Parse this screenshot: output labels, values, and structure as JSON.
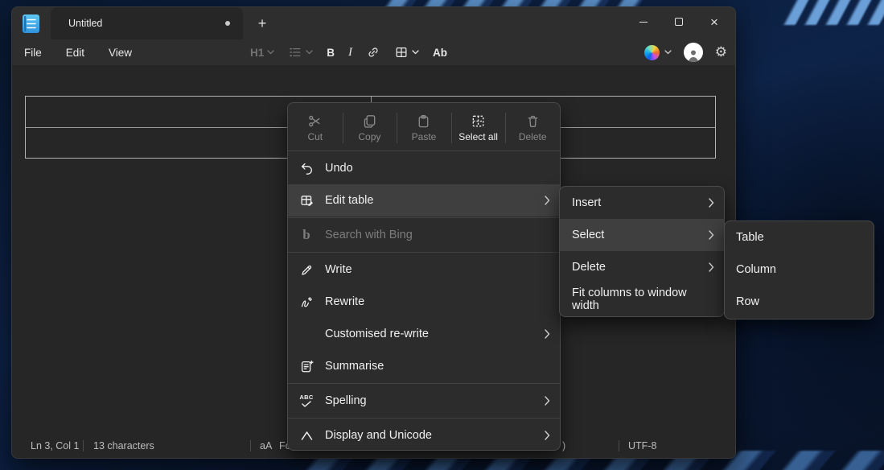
{
  "titlebar": {
    "tab_title": "Untitled",
    "unsaved_indicator": "unsaved-dot",
    "new_tab_label": "+",
    "close_label": "×"
  },
  "menubar": {
    "file": "File",
    "edit": "Edit",
    "view": "View"
  },
  "toolbar": {
    "heading_label": "H1",
    "bold_label": "B",
    "italic_label": "I",
    "proofing_label": "Ab"
  },
  "icons": {
    "gear": "⚙",
    "names": [
      "notepad-icon",
      "list-icon",
      "link-icon",
      "table-icon",
      "copilot-icon",
      "account-icon",
      "gear-icon",
      "scissors-icon",
      "copy-icon",
      "paste-icon",
      "select-all-icon",
      "trash-icon",
      "undo-icon",
      "edit-table-icon",
      "bing-icon",
      "write-icon",
      "rewrite-icon",
      "summarise-icon",
      "spelling-icon",
      "caret-icon",
      "chevron-down-icon",
      "chevron-right-icon"
    ]
  },
  "context_menu": {
    "commands": [
      {
        "label": "Cut",
        "enabled": false
      },
      {
        "label": "Copy",
        "enabled": false
      },
      {
        "label": "Paste",
        "enabled": false
      },
      {
        "label": "Select all",
        "enabled": true
      },
      {
        "label": "Delete",
        "enabled": false
      }
    ],
    "items": [
      {
        "label": "Undo",
        "enabled": true,
        "highlighted": false,
        "chevron": false
      },
      {
        "label": "Edit table",
        "enabled": true,
        "highlighted": true,
        "chevron": true
      },
      {
        "label": "Search with Bing",
        "enabled": false,
        "highlighted": false,
        "chevron": false
      },
      {
        "label": "Write",
        "enabled": true,
        "highlighted": false,
        "chevron": false
      },
      {
        "label": "Rewrite",
        "enabled": true,
        "highlighted": false,
        "chevron": false
      },
      {
        "label": "Customised re-write",
        "enabled": true,
        "highlighted": false,
        "chevron": true
      },
      {
        "label": "Summarise",
        "enabled": true,
        "highlighted": false,
        "chevron": false
      },
      {
        "label": "Spelling",
        "enabled": true,
        "highlighted": false,
        "chevron": true
      },
      {
        "label": "Display and Unicode",
        "enabled": true,
        "highlighted": false,
        "chevron": true
      }
    ]
  },
  "edit_table_submenu": {
    "items": [
      {
        "label": "Insert",
        "highlighted": false,
        "chevron": true
      },
      {
        "label": "Select",
        "highlighted": true,
        "chevron": true
      },
      {
        "label": "Delete",
        "highlighted": false,
        "chevron": true
      },
      {
        "label": "Fit columns to window width",
        "highlighted": false,
        "chevron": false
      }
    ]
  },
  "select_submenu": {
    "items": [
      {
        "label": "Table"
      },
      {
        "label": "Column"
      },
      {
        "label": "Row"
      }
    ]
  },
  "statusbar": {
    "cursor_position": "Ln 3, Col 1",
    "character_count": "13 characters",
    "text_size_icon_label": "aA",
    "clipped_left_label": "Fo",
    "clipped_right_label": ")",
    "encoding": "UTF-8"
  },
  "colors": {
    "chrome_bg": "#2e2e2e",
    "editor_bg": "#262626",
    "menu_bg": "#2c2c2c",
    "menu_highlight": "#3f3f3f",
    "text_primary": "#f0f0f0",
    "text_disabled": "#7d7d7d",
    "wallpaper_base": "#0d2348",
    "app_icon_blue": "#2e93dd"
  }
}
